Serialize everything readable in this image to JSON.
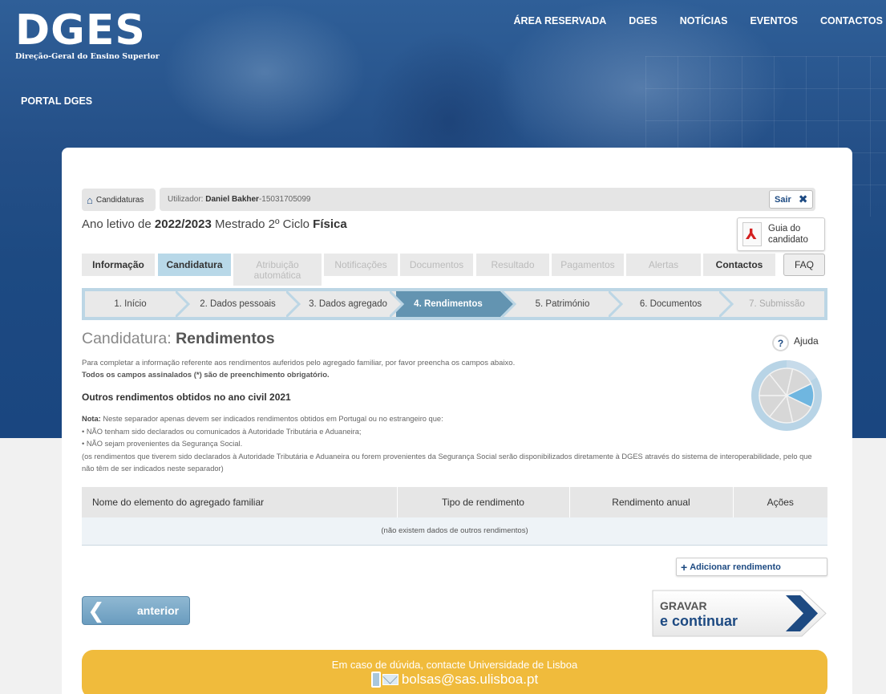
{
  "header": {
    "logo_main": "DGES",
    "logo_sub": "Direção-Geral do Ensino Superior",
    "nav": [
      "ÁREA RESERVADA",
      "DGES",
      "NOTÍCIAS",
      "EVENTOS",
      "CONTACTOS"
    ],
    "portal": "PORTAL DGES"
  },
  "breadcrumb": {
    "home": "Candidaturas"
  },
  "user": {
    "label": "Utilizador:",
    "name": "Daniel Bakher",
    "separator": " - ",
    "id": "15031705099",
    "logout": "Sair"
  },
  "year": {
    "prefix": "Ano letivo de ",
    "value": "2022/2023",
    "program": " Mestrado 2º Ciclo ",
    "course": "Física"
  },
  "guide": {
    "line1": "Guia do",
    "line2": "candidato"
  },
  "tabs": [
    {
      "label": "Informação",
      "state": "enabled"
    },
    {
      "label": "Candidatura",
      "state": "active"
    },
    {
      "label": "Atribuição automática",
      "state": "disabled"
    },
    {
      "label": "Notificações",
      "state": "disabled"
    },
    {
      "label": "Documentos",
      "state": "disabled"
    },
    {
      "label": "Resultado",
      "state": "disabled"
    },
    {
      "label": "Pagamentos",
      "state": "disabled"
    },
    {
      "label": "Alertas",
      "state": "disabled"
    },
    {
      "label": "Contactos",
      "state": "enabled"
    }
  ],
  "faq": "FAQ",
  "steps": [
    {
      "label": "1. Início",
      "state": "done"
    },
    {
      "label": "2. Dados pessoais",
      "state": "done"
    },
    {
      "label": "3. Dados agregado",
      "state": "done"
    },
    {
      "label": "4. Rendimentos",
      "state": "active"
    },
    {
      "label": "5. Património",
      "state": "todo"
    },
    {
      "label": "6. Documentos",
      "state": "todo"
    },
    {
      "label": "7. Submissão",
      "state": "disabled"
    }
  ],
  "page": {
    "title_prefix": "Candidatura: ",
    "title": "Rendimentos",
    "help": "Ajuda",
    "help_icon": "?",
    "intro1": "Para completar a informação referente aos rendimentos auferidos pelo agregado familiar, por favor preencha os campos abaixo.",
    "intro2": "Todos os campos assinalados (*) são de preenchimento obrigatório.",
    "subtitle": "Outros rendimentos obtidos no ano civil 2021",
    "note_label": "Nota:",
    "note_text": " Neste separador apenas devem ser indicados rendimentos obtidos em Portugal ou no estrangeiro que:",
    "note_b1": "• NÃO tenham sido declarados ou comunicados à Autoridade Tributária e Aduaneira;",
    "note_b2": "• NÃO sejam provenientes da Segurança Social.",
    "note_p": "(os rendimentos que tiverem sido declarados à Autoridade Tributária e Aduaneira ou forem provenientes da Segurança Social serão disponibilizados diretamente à DGES através do sistema de interoperabilidade, pelo que não têm de ser indicados neste separador)"
  },
  "progress": {
    "completed_fraction": 0.14,
    "segments": 7
  },
  "table": {
    "columns": [
      "Nome do elemento do agregado familiar",
      "Tipo de rendimento",
      "Rendimento anual",
      "Ações"
    ],
    "empty": "(não existem dados de outros rendimentos)"
  },
  "actions": {
    "add": "Adicionar rendimento",
    "back": "anterior",
    "save_line1": "GRAVAR",
    "save_line2": "e continuar"
  },
  "contact": {
    "text": "Em caso de dúvida, contacte Universidade de Lisboa",
    "email": "bolsas@sas.ulisboa.pt"
  },
  "colors": {
    "brand": "#1d4a82",
    "active_step": "#6394b1",
    "active_tab": "#b8d8e8",
    "contact_bg": "#f0bb3c"
  }
}
